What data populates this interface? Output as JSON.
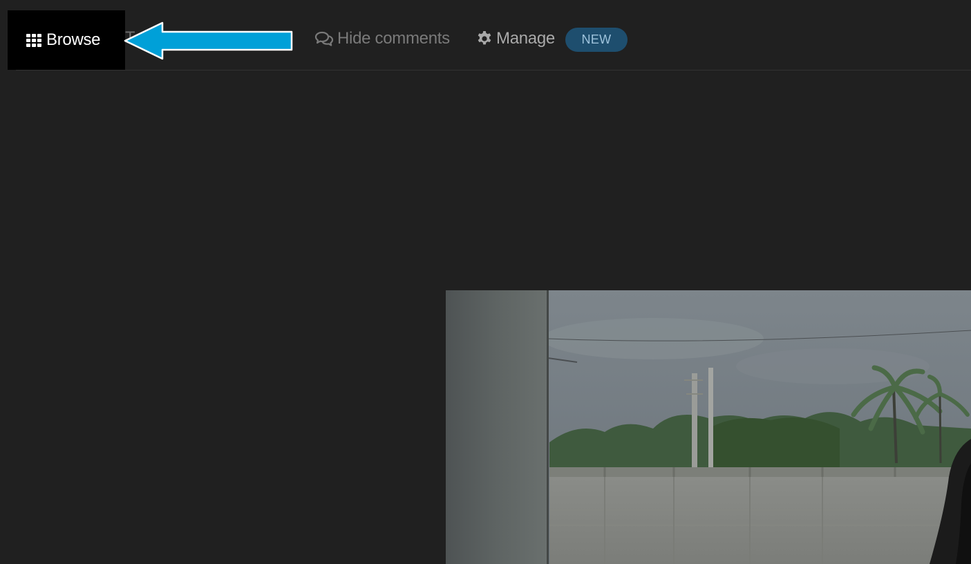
{
  "toolbar": {
    "browse_label": "Browse",
    "hide_comments_label": "Hide comments",
    "manage_label": "Manage",
    "new_badge": "NEW"
  },
  "icons": {
    "browse": "grid-icon",
    "hide_comments": "comments-icon",
    "manage": "gear-icon",
    "annotation": "arrow-left-icon"
  },
  "colors": {
    "background": "#202020",
    "browse_bg": "#000000",
    "arrow_fill": "#00a0d8",
    "badge_bg": "#1e4e6e"
  }
}
